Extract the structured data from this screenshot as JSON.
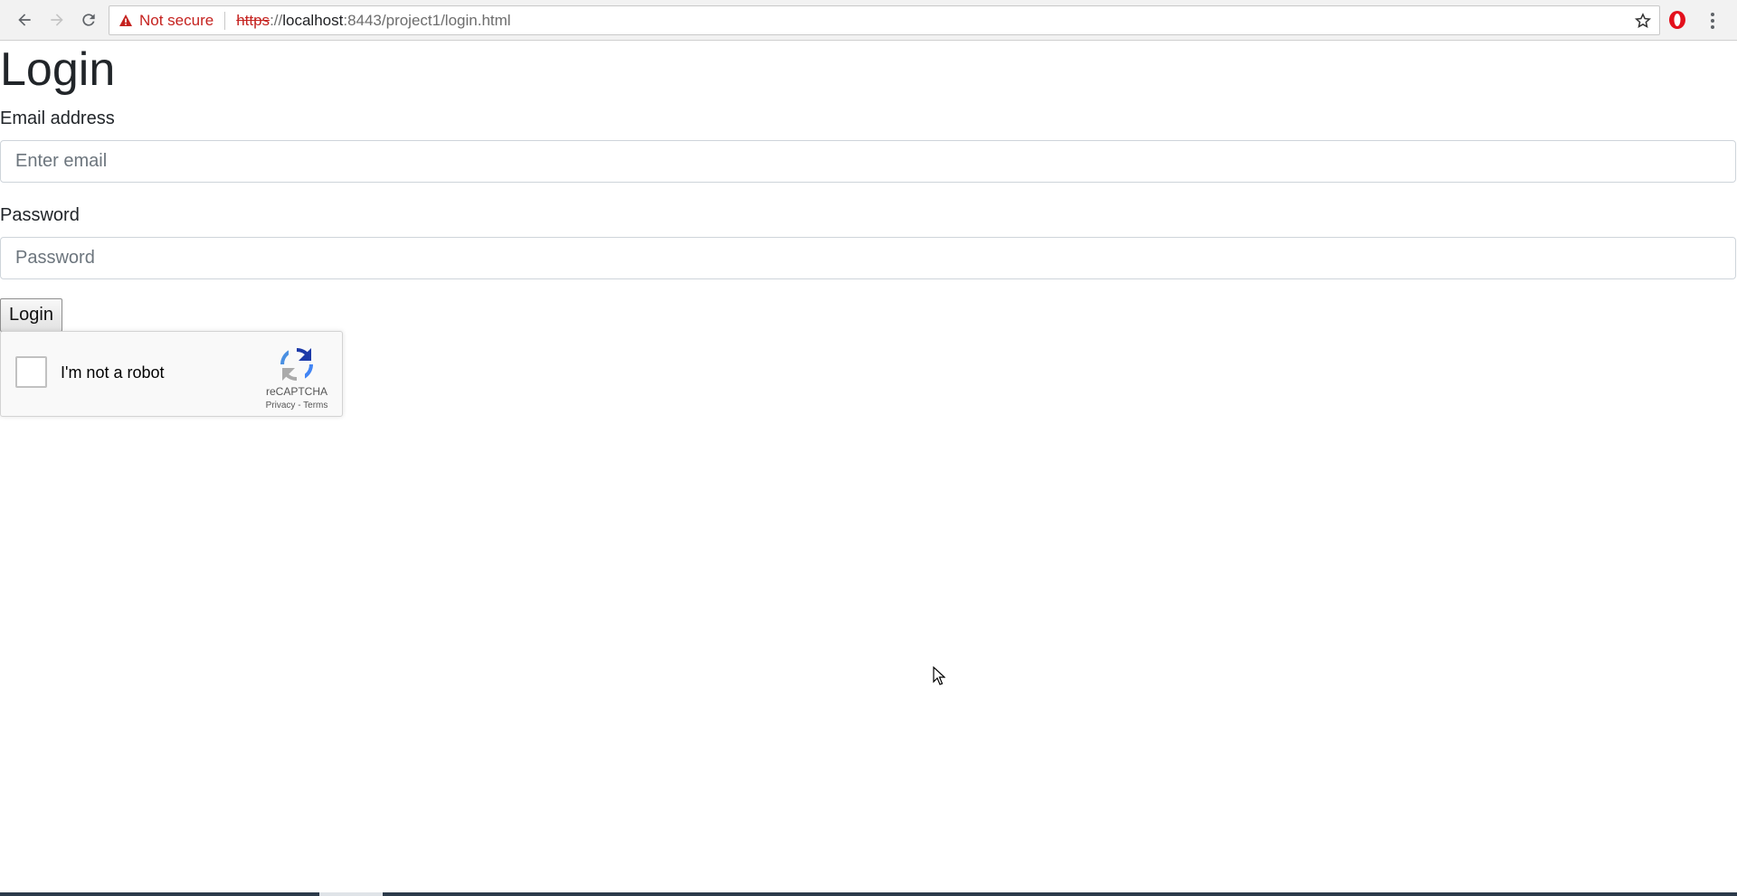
{
  "browser": {
    "security_label": "Not secure",
    "url_scheme": "https",
    "url_sep": "://",
    "url_host": "localhost",
    "url_rest": ":8443/project1/login.html",
    "icons": [
      "back-arrow-icon",
      "forward-arrow-icon",
      "reload-icon",
      "warning-icon",
      "star-icon",
      "opera-icon",
      "menu-dots-icon"
    ]
  },
  "page": {
    "title": "Login",
    "email_label": "Email address",
    "email_placeholder": "Enter email",
    "password_label": "Password",
    "password_placeholder": "Password",
    "login_button": "Login"
  },
  "recaptcha": {
    "checkbox_label": "I'm not a robot",
    "brand": "reCAPTCHA",
    "privacy": "Privacy",
    "dash": " - ",
    "terms": "Terms"
  },
  "colors": {
    "insecure": "#c5221f",
    "text": "#212529",
    "input_border": "#ced4da"
  }
}
